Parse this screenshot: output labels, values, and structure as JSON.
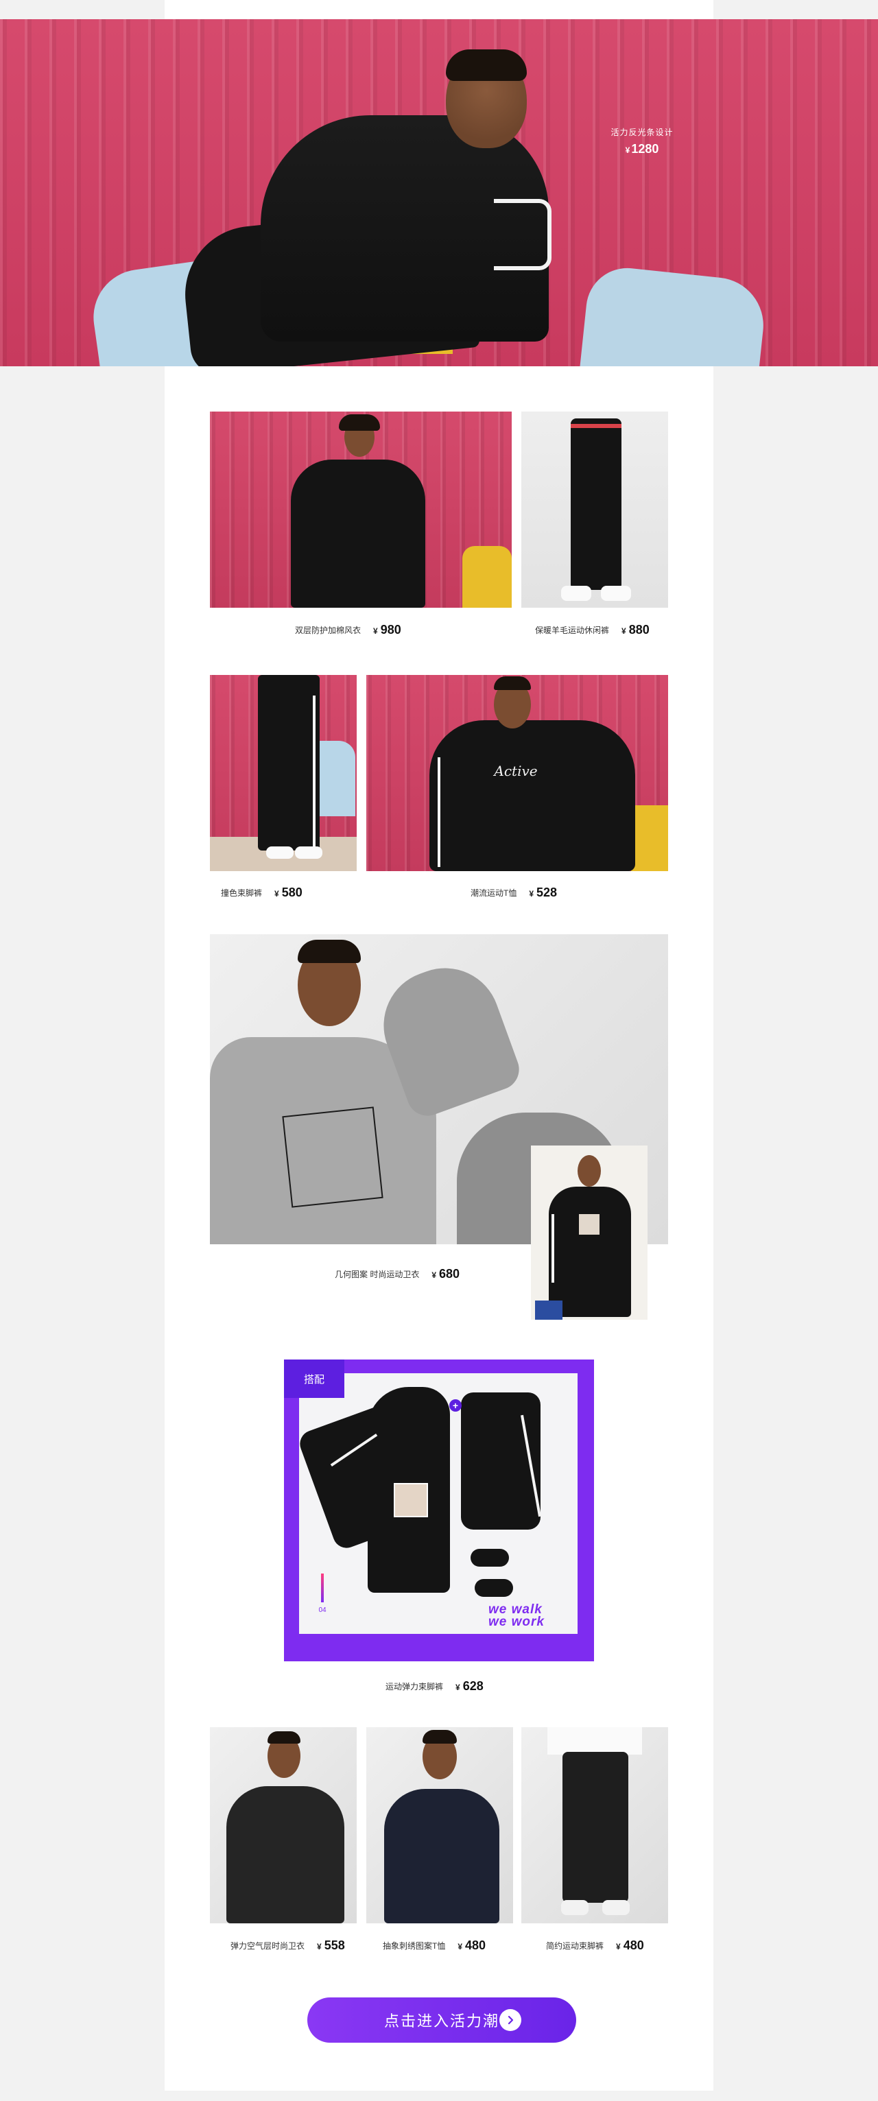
{
  "hero": {
    "subtitle": "活力反光条设计",
    "currency": "¥",
    "price": "1280"
  },
  "products": [
    {
      "name": "双层防护加棉风衣",
      "currency": "¥",
      "price": "980"
    },
    {
      "name": "保暖羊毛运动休闲裤",
      "currency": "¥",
      "price": "880"
    },
    {
      "name": "撞色束脚裤",
      "currency": "¥",
      "price": "580"
    },
    {
      "name": "潮流运动T恤",
      "currency": "¥",
      "price": "528"
    },
    {
      "name": "几何图案 时尚运动卫衣",
      "currency": "¥",
      "price": "680"
    },
    {
      "name": "运动弹力束脚裤",
      "currency": "¥",
      "price": "628"
    },
    {
      "name": "弹力空气层时尚卫衣",
      "currency": "¥",
      "price": "558"
    },
    {
      "name": "抽象刺绣图案T恤",
      "currency": "¥",
      "price": "480"
    },
    {
      "name": "简约运动束脚裤",
      "currency": "¥",
      "price": "480"
    }
  ],
  "combo": {
    "tag": "搭配",
    "plus": "+",
    "number": "04",
    "tagline_line1": "we walk",
    "tagline_line2": "we work"
  },
  "tshirt_print": "Active",
  "cta": {
    "label": "点击进入活力潮",
    "arrow_icon": "chevron-right-icon"
  },
  "colors": {
    "accent_purple": "#7e2cf0",
    "hero_red": "#d54a6c"
  }
}
